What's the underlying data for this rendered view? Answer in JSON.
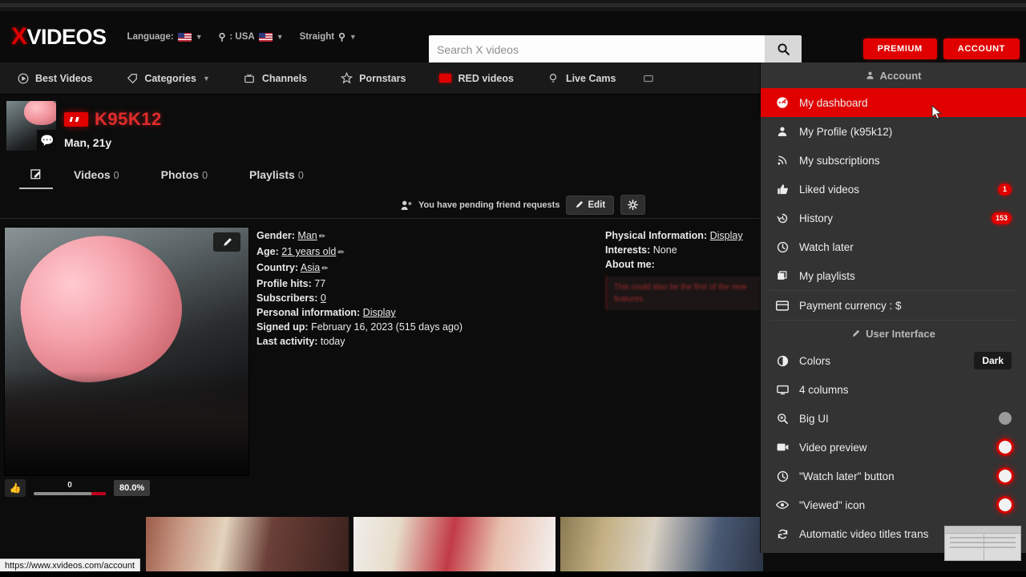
{
  "header": {
    "logo_x": "X",
    "logo_rest": "VIDEOS",
    "language_label": "Language:",
    "country_label": ": USA",
    "orientation_label": "Straight",
    "premium_button": "PREMIUM",
    "account_button": "ACCOUNT"
  },
  "search": {
    "placeholder": "Search X videos",
    "value": ""
  },
  "nav": {
    "items": [
      {
        "label": "Best Videos",
        "icon": "play-circle-icon",
        "caret": false
      },
      {
        "label": "Categories",
        "icon": "tag-icon",
        "caret": true
      },
      {
        "label": "Channels",
        "icon": "tv-icon",
        "caret": false
      },
      {
        "label": "Pornstars",
        "icon": "star-icon",
        "caret": false
      },
      {
        "label": "RED videos",
        "icon": "red-chip-icon",
        "caret": false
      },
      {
        "label": "Live Cams",
        "icon": "bulb-icon",
        "caret": false
      }
    ]
  },
  "profile": {
    "username": "K95K12",
    "subline": "Man, 21y",
    "tabs": [
      {
        "label": "Videos",
        "count": "0"
      },
      {
        "label": "Photos",
        "count": "0"
      },
      {
        "label": "Playlists",
        "count": "0"
      }
    ],
    "friend_notice": "You have pending friend requests",
    "edit_button": "Edit"
  },
  "info_left": [
    {
      "label": "Gender:",
      "value": "Man",
      "link": true,
      "pencil": true
    },
    {
      "label": "Age:",
      "value": "21 years old",
      "link": true,
      "pencil": true
    },
    {
      "label": "Country:",
      "value": "Asia",
      "link": true,
      "pencil": true
    },
    {
      "label": "Profile hits:",
      "value": "77",
      "link": false,
      "pencil": false
    },
    {
      "label": "Subscribers:",
      "value": "0",
      "link": true,
      "pencil": false
    },
    {
      "label": "Personal information:",
      "value": "Display",
      "link": true,
      "pencil": false
    },
    {
      "label": "Signed up:",
      "value": "February 16, 2023 (515 days ago)",
      "link": false,
      "pencil": false
    },
    {
      "label": "Last activity:",
      "value": "today",
      "link": false,
      "pencil": false
    }
  ],
  "info_right": [
    {
      "label": "Physical Information:",
      "value": "Display",
      "link": true
    },
    {
      "label": "Interests:",
      "value": "None",
      "link": false
    },
    {
      "label": "About me:",
      "value": "",
      "link": false
    }
  ],
  "about_me_box": "This could also be the first of the new features",
  "rating": {
    "likes": "0",
    "percent": "80.0%"
  },
  "sidebar": {
    "section_account": "Account",
    "section_ui": "User Interface",
    "items": [
      {
        "label": "My dashboard",
        "icon": "dashboard-icon",
        "active": true,
        "badge": "",
        "pill": "",
        "toggle": ""
      },
      {
        "label": "My Profile (k95k12)",
        "icon": "user-icon",
        "active": false,
        "badge": "",
        "pill": "",
        "toggle": ""
      },
      {
        "label": "My subscriptions",
        "icon": "rss-icon",
        "active": false,
        "badge": "",
        "pill": "",
        "toggle": ""
      },
      {
        "label": "Liked videos",
        "icon": "thumbs-up-icon",
        "active": false,
        "badge": "1",
        "pill": "",
        "toggle": ""
      },
      {
        "label": "History",
        "icon": "history-icon",
        "active": false,
        "badge": "153",
        "pill": "",
        "toggle": ""
      },
      {
        "label": "Watch later",
        "icon": "clock-icon",
        "active": false,
        "badge": "",
        "pill": "",
        "toggle": ""
      },
      {
        "label": "My playlists",
        "icon": "playlist-icon",
        "active": false,
        "badge": "",
        "pill": "",
        "toggle": ""
      },
      {
        "label": "Payment currency : $",
        "icon": "card-icon",
        "active": false,
        "badge": "",
        "pill": "",
        "toggle": ""
      }
    ],
    "ui_items": [
      {
        "label": "Colors",
        "icon": "contrast-icon",
        "pill": "Dark",
        "toggle": ""
      },
      {
        "label": "4 columns",
        "icon": "monitor-icon",
        "pill": "",
        "toggle": ""
      },
      {
        "label": "Big UI",
        "icon": "zoom-icon",
        "pill": "",
        "toggle": "off"
      },
      {
        "label": "Video preview",
        "icon": "video-icon",
        "pill": "",
        "toggle": "on"
      },
      {
        "label": "\"Watch later\" button",
        "icon": "clock-icon",
        "pill": "",
        "toggle": "on"
      },
      {
        "label": "\"Viewed\" icon",
        "icon": "eye-icon",
        "pill": "",
        "toggle": "on"
      },
      {
        "label": "Automatic video titles trans",
        "icon": "refresh-icon",
        "pill": "",
        "toggle": ""
      }
    ]
  },
  "statusbar": {
    "url": "https://www.xvideos.com/account"
  }
}
